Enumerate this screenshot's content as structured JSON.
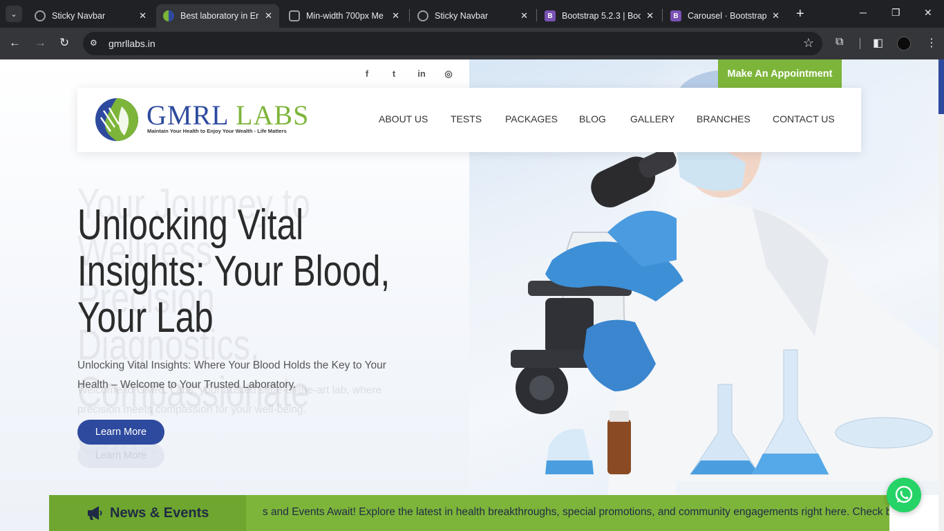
{
  "browser": {
    "tabs": [
      {
        "title": "Sticky Navbar",
        "favicon": "globe-icon",
        "active": false
      },
      {
        "title": "Best laboratory in Ern",
        "favicon": "gmrl-icon",
        "active": true
      },
      {
        "title": "Min-width 700px Me",
        "favicon": "chatgpt-icon",
        "active": false
      },
      {
        "title": "Sticky Navbar",
        "favicon": "globe-icon",
        "active": false
      },
      {
        "title": "Bootstrap 5.2.3 | Boo",
        "favicon": "bootstrap-icon",
        "active": false
      },
      {
        "title": "Carousel · Bootstrap",
        "favicon": "bootstrap-icon",
        "active": false
      }
    ],
    "url": "gmrllabs.in",
    "bootstrap_letter": "B"
  },
  "site": {
    "appointment_label": "Make An Appointment",
    "social": [
      "facebook-icon",
      "twitter-icon",
      "linkedin-icon",
      "instagram-icon"
    ],
    "social_glyphs": [
      "f",
      "t",
      "in",
      "◎"
    ],
    "logo": {
      "name_part1": "GMRL",
      "name_part2": "LABS",
      "tagline": "Maintain Your Health to Enjoy Your Wealth - Life Matters"
    },
    "nav": [
      "ABOUT US",
      "TESTS",
      "PACKAGES",
      "BLOG",
      "GALLERY",
      "BRANCHES",
      "CONTACT US"
    ],
    "hero": {
      "title": "Unlocking Vital Insights: Your Blood, Your Lab",
      "ghost_title": "Your Journey to Wellness Precision Diagnostics, Compassionate Care.",
      "subtitle": "Unlocking Vital Insights: Where Your Blood Holds the Key to Your Health – Welcome to Your Trusted Laboratory.",
      "ghost_subtitle": "Welcome to GMRL Labs, your trusted state-of-the-art lab, where precision meets compassion for your well-being.",
      "button": "Learn More",
      "ghost_button": "Learn More"
    },
    "news": {
      "label": "News & Events",
      "ticker": "s and Events Await! Explore the latest in health breakthroughs, special promotions, and community engagements right here. Check back c"
    }
  },
  "colors": {
    "brand_blue": "#2e4a9e",
    "brand_green": "#7db53a",
    "whatsapp": "#25d366"
  }
}
